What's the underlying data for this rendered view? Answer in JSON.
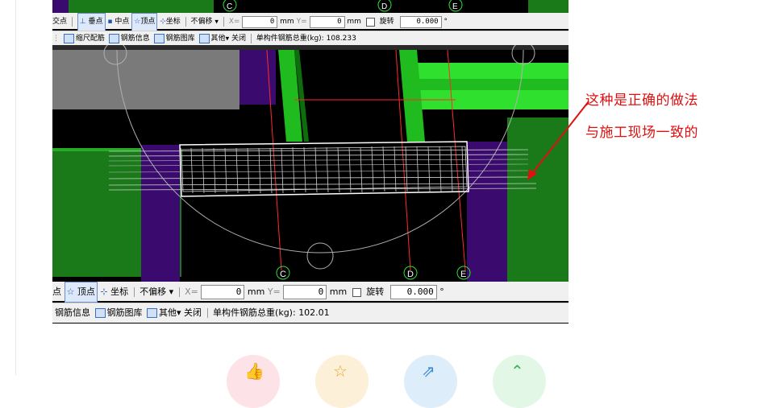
{
  "toolbar_top": {
    "snap_intersection": "交点",
    "snap_perpendicular": "垂点",
    "snap_midpoint": "中点",
    "snap_vertex": "顶点",
    "coordinate": "坐标",
    "offset_mode": "不偏移",
    "x_label": "X=",
    "x_value": "0",
    "y_label": "Y=",
    "y_value": "0",
    "unit": "mm",
    "rotate": "旋转",
    "rotate_value": "0.000",
    "degree": "°",
    "tool_reinf_scale": "缩尺配筋",
    "tool_rebar_info": "钢筋信息",
    "tool_rebar_lib": "钢筋图库",
    "other": "其他",
    "close": "关闭",
    "total_label": "单构件钢筋总重(kg):",
    "total_value": "108.233"
  },
  "toolbar_bottom": {
    "snap_vertex_partial": "点",
    "snap_vertex": "顶点",
    "coordinate": "坐标",
    "offset_mode": "不偏移",
    "x_label": "X=",
    "x_value": "0",
    "y_label": "Y=",
    "y_value": "0",
    "unit": "mm",
    "rotate": "旋转",
    "rotate_value": "0.000",
    "degree": "°",
    "tool_rebar_info": "钢筋信息",
    "tool_rebar_lib": "钢筋图库",
    "other": "其他",
    "close": "关闭",
    "total_label": "单构件钢筋总重(kg):",
    "total_value": "102.01"
  },
  "axis_labels": {
    "c": "C",
    "d": "D",
    "e": "E"
  },
  "annotation": {
    "line1": "这种是正确的做法",
    "line2": "与施工现场一致的"
  },
  "actions": {
    "like_icon": "thumb-up-icon",
    "favorite_icon": "star-icon",
    "share_icon": "share-icon",
    "top_icon": "arrow-up-icon"
  },
  "colors": {
    "annotation": "#e01010",
    "green": "#1aa61a",
    "bright_green": "#2fe02f",
    "purple": "#3a0a6e",
    "gray": "#7a7a7a",
    "like": "#fde3e8",
    "favorite": "#fdf0d8",
    "share": "#ddeefa",
    "top": "#e2f7e6"
  }
}
